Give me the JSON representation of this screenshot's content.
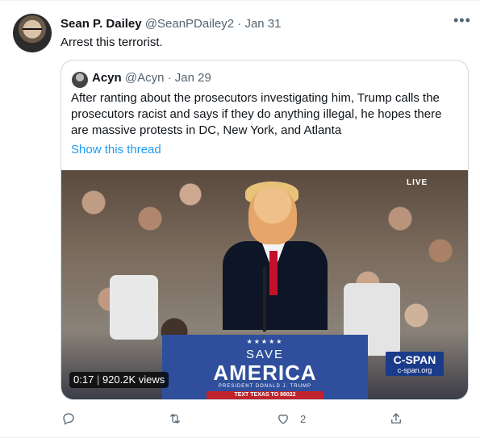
{
  "tweet": {
    "author_name": "Sean P. Dailey",
    "author_handle": "@SeanPDailey2",
    "separator": "·",
    "date": "Jan 31",
    "text": "Arrest this terrorist.",
    "more_icon": "more-horizontal-icon"
  },
  "quoted_tweet": {
    "author_name": "Acyn",
    "author_handle": "@Acyn",
    "separator": "·",
    "date": "Jan 29",
    "text": "After ranting about the prosecutors investigating him, Trump calls the prosecutors racist and says if they do anything illegal, he hopes there are massive protests in DC, New York, and Atlanta",
    "show_thread_label": "Show this thread",
    "video": {
      "live_badge": "LIVE",
      "podium_stars": "★★★★★",
      "podium_line1": "SAVE",
      "podium_line2": "AMERICA",
      "podium_line3": "PRESIDENT DONALD J. TRUMP",
      "podium_text_bar": "TEXT TEXAS TO 88022",
      "network_logo": "C-SPAN",
      "network_url": "c-span.org",
      "duration": "0:17",
      "views": "920.2K views"
    }
  },
  "actions": {
    "reply_icon": "reply-icon",
    "retweet_icon": "retweet-icon",
    "like_icon": "heart-icon",
    "like_count": "2",
    "share_icon": "share-icon"
  },
  "colors": {
    "link": "#1d9bf0",
    "secondary_text": "#536471",
    "border": "#cfd9de"
  }
}
